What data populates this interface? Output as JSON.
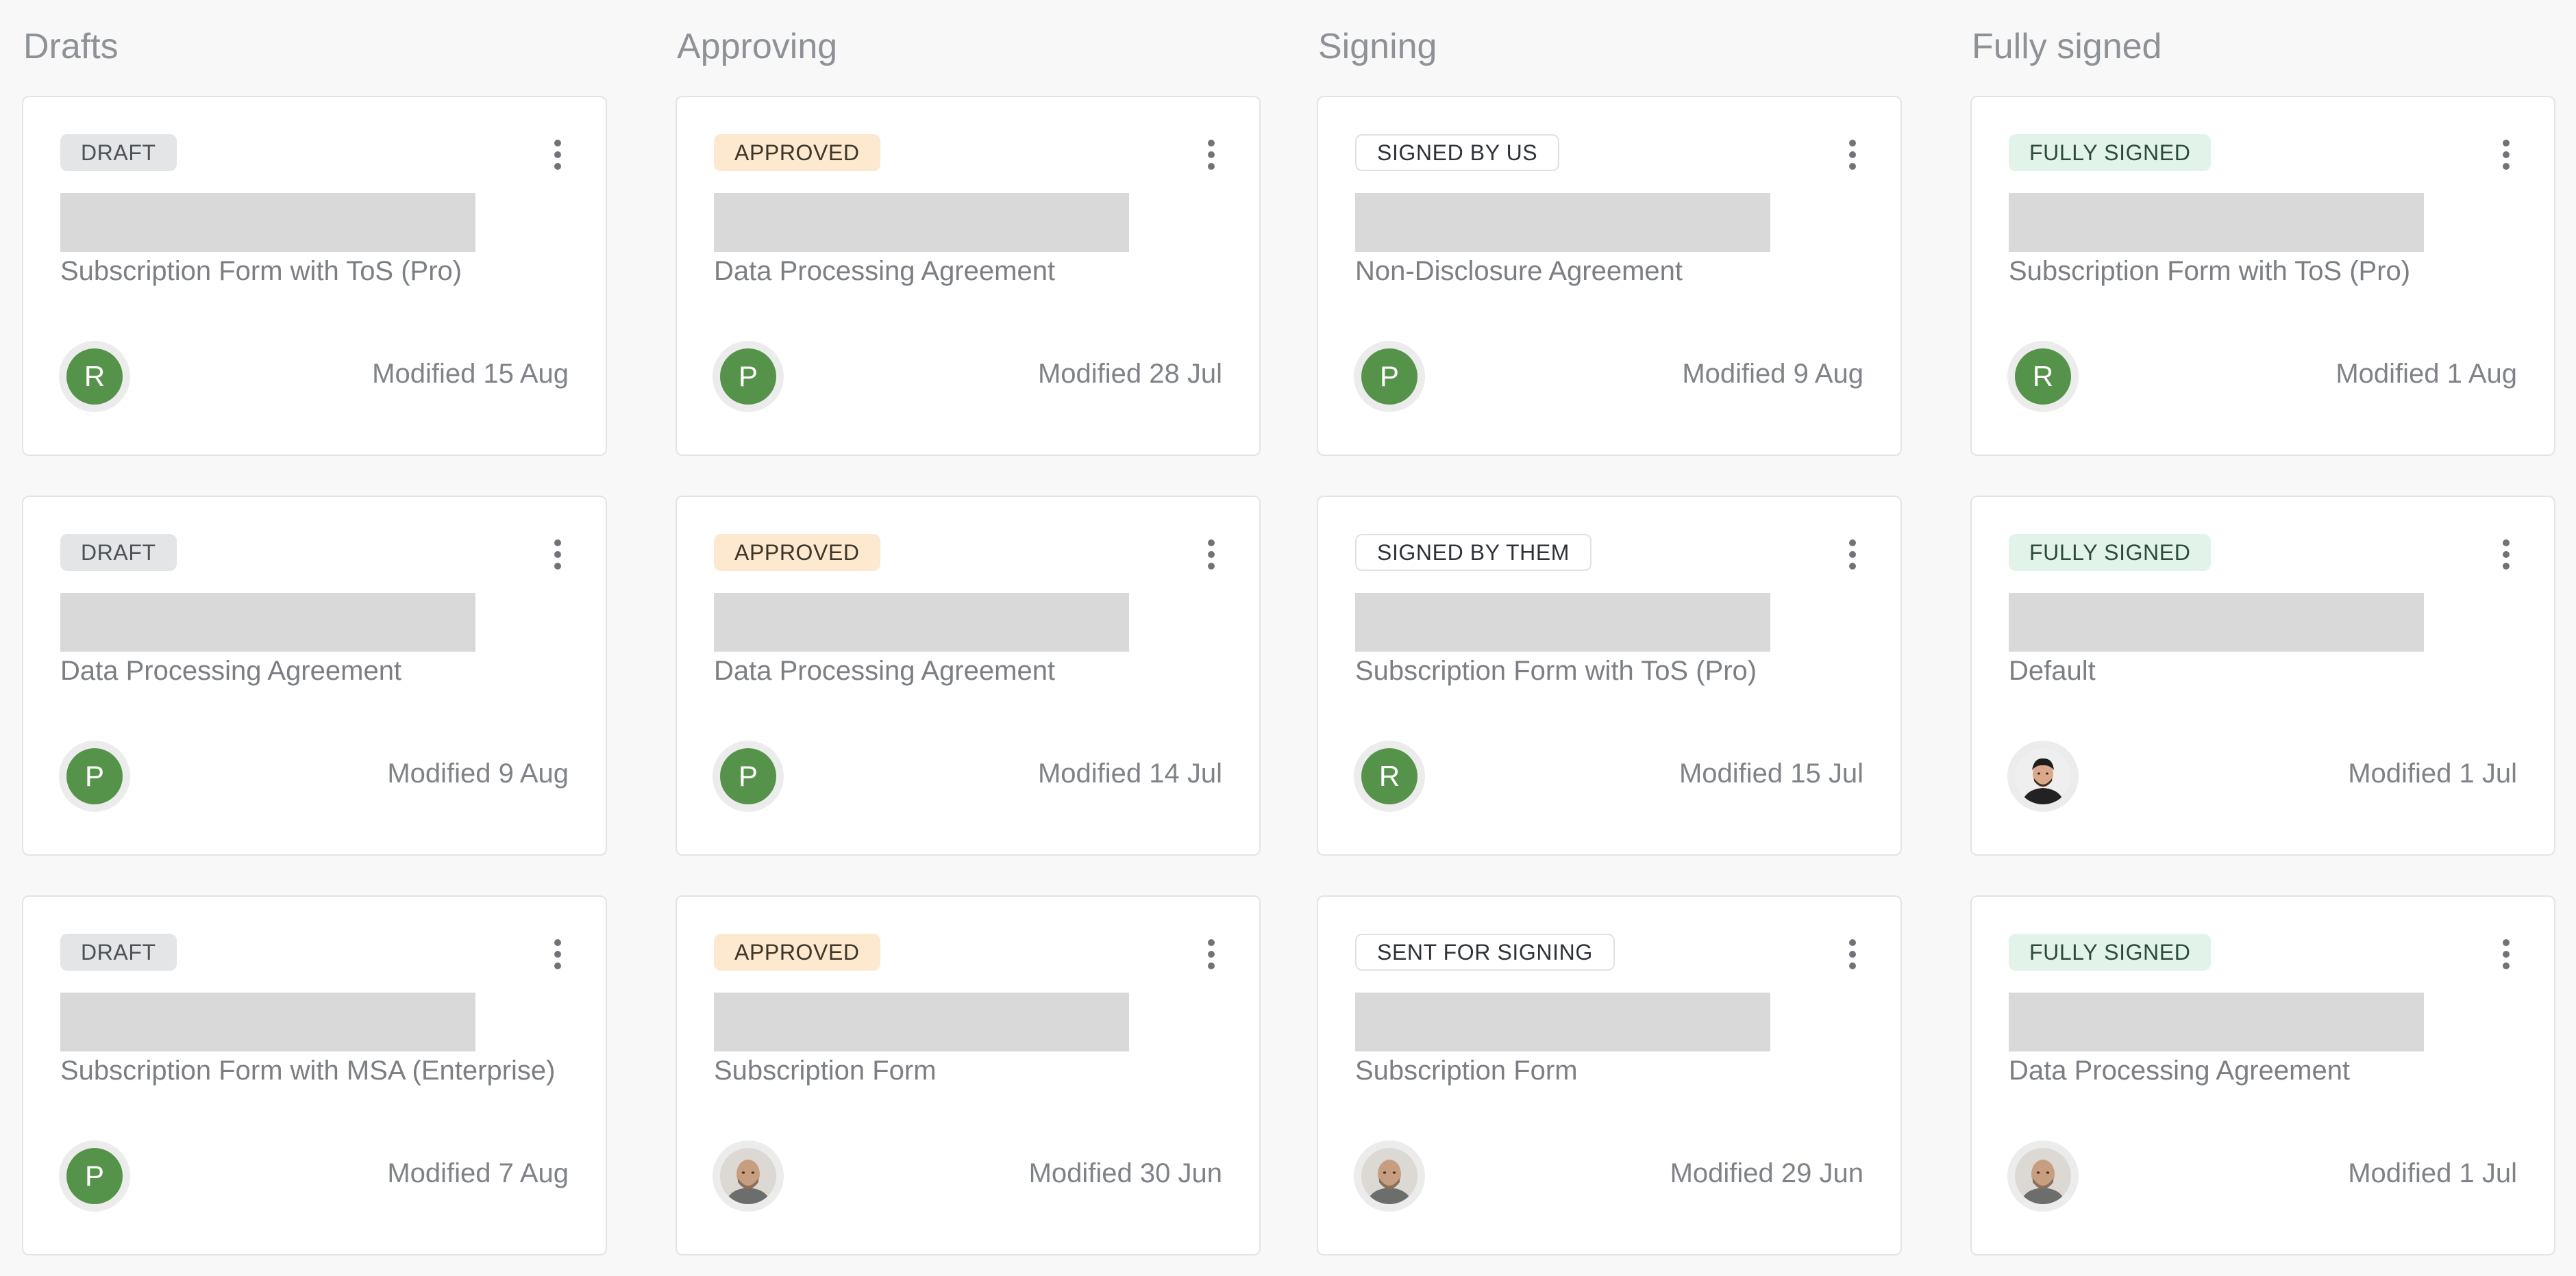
{
  "columns": [
    {
      "title": "Drafts",
      "cards": [
        {
          "badge": "DRAFT",
          "badge_style": "draft",
          "name": "Subscription Form with ToS (Pro)",
          "avatar": {
            "type": "initial",
            "text": "R",
            "color": "#55934a"
          },
          "modified": "Modified 15 Aug"
        },
        {
          "badge": "DRAFT",
          "badge_style": "draft",
          "name": "Data Processing Agreement",
          "avatar": {
            "type": "initial",
            "text": "P",
            "color": "#55934a"
          },
          "modified": "Modified 9 Aug"
        },
        {
          "badge": "DRAFT",
          "badge_style": "draft",
          "name": "Subscription Form with MSA (Enterprise)",
          "avatar": {
            "type": "initial",
            "text": "P",
            "color": "#55934a"
          },
          "modified": "Modified 7 Aug"
        }
      ]
    },
    {
      "title": "Approving",
      "cards": [
        {
          "badge": "APPROVED",
          "badge_style": "approved",
          "name": "Data Processing Agreement",
          "avatar": {
            "type": "initial",
            "text": "P",
            "color": "#55934a"
          },
          "modified": "Modified 28 Jul"
        },
        {
          "badge": "APPROVED",
          "badge_style": "approved",
          "name": "Data Processing Agreement",
          "avatar": {
            "type": "initial",
            "text": "P",
            "color": "#55934a"
          },
          "modified": "Modified 14 Jul"
        },
        {
          "badge": "APPROVED",
          "badge_style": "approved",
          "name": "Subscription Form",
          "avatar": {
            "type": "photo",
            "icon": "bald-man-beard-photo"
          },
          "modified": "Modified 30 Jun"
        }
      ]
    },
    {
      "title": "Signing",
      "cards": [
        {
          "badge": "SIGNED BY US",
          "badge_style": "signing",
          "name": "Non-Disclosure Agreement",
          "avatar": {
            "type": "initial",
            "text": "P",
            "color": "#55934a"
          },
          "modified": "Modified 9 Aug"
        },
        {
          "badge": "SIGNED BY THEM",
          "badge_style": "signing",
          "name": "Subscription Form with ToS (Pro)",
          "avatar": {
            "type": "initial",
            "text": "R",
            "color": "#55934a"
          },
          "modified": "Modified 15 Jul"
        },
        {
          "badge": "SENT FOR SIGNING",
          "badge_style": "signing",
          "name": "Subscription Form",
          "avatar": {
            "type": "photo",
            "icon": "bald-man-beard-photo"
          },
          "modified": "Modified 29 Jun"
        }
      ]
    },
    {
      "title": "Fully signed",
      "cards": [
        {
          "badge": "FULLY SIGNED",
          "badge_style": "fully",
          "name": "Subscription Form with ToS (Pro)",
          "avatar": {
            "type": "initial",
            "text": "R",
            "color": "#55934a"
          },
          "modified": "Modified 1 Aug"
        },
        {
          "badge": "FULLY SIGNED",
          "badge_style": "fully",
          "name": "Default",
          "avatar": {
            "type": "photo",
            "icon": "dark-hair-man-photo"
          },
          "modified": "Modified 1 Jul"
        },
        {
          "badge": "FULLY SIGNED",
          "badge_style": "fully",
          "name": "Data Processing Agreement",
          "avatar": {
            "type": "photo",
            "icon": "bald-man-beard-photo"
          },
          "modified": "Modified 1 Jul"
        }
      ]
    }
  ],
  "colors": {
    "badge_draft_bg": "#e4e5e7",
    "badge_approved_bg": "#fde9cf",
    "badge_fully_bg": "#e2f3ea",
    "avatar_green": "#55934a",
    "placeholder_gray": "#d9d9d9"
  }
}
